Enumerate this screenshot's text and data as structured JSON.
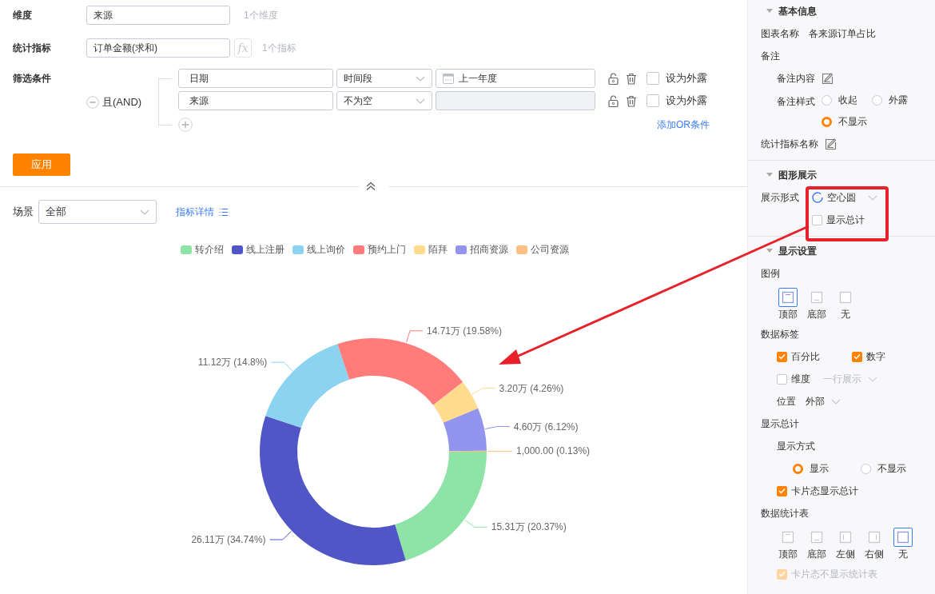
{
  "query": {
    "dimension": {
      "label": "维度",
      "value": "来源",
      "hint": "1个维度"
    },
    "metric": {
      "label": "统计指标",
      "value": "订单金额(求和)",
      "fx": "fx",
      "hint": "1个指标"
    },
    "filters": {
      "label": "筛选条件",
      "logic": "且(AND)",
      "rows": [
        {
          "field": "日期",
          "operator": "时间段",
          "value": "上一年度",
          "kind": "date",
          "disabled": false,
          "expose_label": "设为外露",
          "exposed": false
        },
        {
          "field": "来源",
          "operator": "不为空",
          "kind": "text",
          "disabled": true,
          "expose_label": "设为外露",
          "exposed": false
        }
      ],
      "add_or": "添加OR条件"
    },
    "apply_button": "应用"
  },
  "scene": {
    "label": "场景",
    "value": "全部"
  },
  "metric_details_link": "指标详情",
  "legend": [
    {
      "color": "#8ee4a7"
    },
    {
      "color": "#5156c6"
    },
    {
      "color": "#8bd3f0"
    },
    {
      "color": "#ff7c7b"
    },
    {
      "color": "#ffdc8c"
    },
    {
      "color": "#9394ee"
    },
    {
      "color": "#ffbe84"
    }
  ],
  "chart_data": {
    "type": "donut",
    "categories": [
      "转介绍",
      "线上注册",
      "线上询价",
      "预约上门",
      "陌拜",
      "招商资源",
      "公司资源"
    ],
    "values": [
      20.37,
      34.74,
      14.8,
      19.58,
      4.26,
      6.12,
      0.13
    ],
    "value_labels": [
      "15.31万 (20.37%)",
      "26.11万 (34.74%)",
      "11.12万 (14.8%)",
      "14.71万 (19.58%)",
      "3.20万 (4.26%)",
      "4.60万 (6.12%)",
      "1,000.00 (0.13%)"
    ]
  },
  "panel": {
    "sections": [
      {
        "title": "基本信息",
        "expanded": true,
        "rows": [
          {
            "kind": "text",
            "label": "图表名称",
            "value": "各来源订单占比"
          },
          {
            "kind": "group",
            "label": "备注",
            "children": [
              {
                "kind": "edit",
                "label": "备注内容"
              },
              {
                "kind": "radios",
                "label": "备注样式",
                "options": [
                  {
                    "label": "收起",
                    "selected": false
                  },
                  {
                    "label": "外露",
                    "selected": false
                  },
                  {
                    "label": "不显示",
                    "selected": true
                  }
                ]
              }
            ]
          },
          {
            "kind": "edit",
            "label": "统计指标名称"
          }
        ]
      },
      {
        "title": "图形展示",
        "expanded": true,
        "rows": [
          {
            "kind": "shape-select",
            "label": "展示形式",
            "value": "空心圆"
          },
          {
            "kind": "checkbox",
            "label": "显示总计",
            "checked": false
          }
        ]
      },
      {
        "title": "显示设置",
        "expanded": true,
        "rows": [
          {
            "kind": "group",
            "label": "图例",
            "children": [
              {
                "kind": "tiles",
                "options": [
                  {
                    "label": "顶部",
                    "kind": "top",
                    "selected": true
                  },
                  {
                    "label": "底部",
                    "kind": "bottom",
                    "selected": false
                  },
                  {
                    "label": "无",
                    "kind": "none",
                    "selected": false
                  }
                ]
              }
            ]
          },
          {
            "kind": "group",
            "label": "数据标签",
            "children": [
              {
                "kind": "checkboxes",
                "items": [
                  {
                    "label": "百分比",
                    "checked": true
                  },
                  {
                    "label": "数字",
                    "checked": true
                  }
                ]
              },
              {
                "kind": "checkbox-select",
                "label": "维度",
                "checked": false,
                "select": {
                  "value": "一行展示",
                  "disabled": true
                }
              },
              {
                "kind": "select",
                "label": "位置",
                "value": "外部"
              }
            ]
          },
          {
            "kind": "group",
            "label": "显示总计",
            "children": [
              {
                "kind": "radios-below",
                "label": "显示方式",
                "options": [
                  {
                    "label": "显示",
                    "selected": true
                  },
                  {
                    "label": "不显示",
                    "selected": false
                  }
                ]
              },
              {
                "kind": "checkbox",
                "label": "卡片态显示总计",
                "checked": true
              }
            ]
          },
          {
            "kind": "group",
            "label": "数据统计表",
            "children": [
              {
                "kind": "tiles",
                "options": [
                  {
                    "label": "顶部",
                    "kind": "top",
                    "selected": false
                  },
                  {
                    "label": "底部",
                    "kind": "bottom",
                    "selected": false
                  },
                  {
                    "label": "左侧",
                    "kind": "left",
                    "selected": false
                  },
                  {
                    "label": "右侧",
                    "kind": "right",
                    "selected": false
                  },
                  {
                    "label": "无",
                    "kind": "none",
                    "selected": true
                  }
                ]
              },
              {
                "kind": "checkbox",
                "label": "卡片态不显示统计表",
                "checked": true,
                "disabled": true
              }
            ]
          }
        ]
      }
    ]
  }
}
